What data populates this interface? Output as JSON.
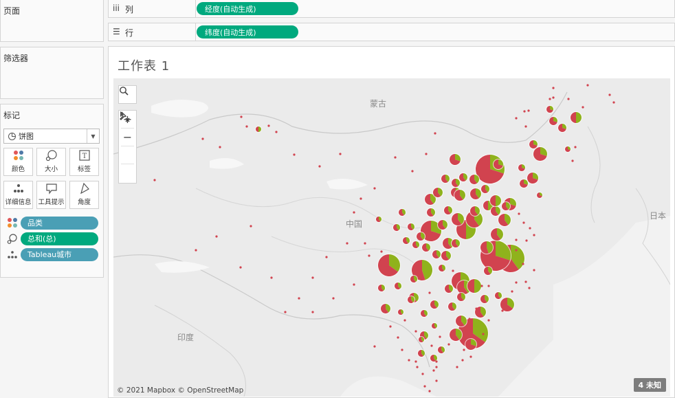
{
  "left": {
    "pages_title": "页面",
    "filters_title": "筛选器",
    "marks_title": "标记",
    "mark_type": "饼图",
    "mark_buttons": [
      {
        "label": "颜色",
        "icon": "color-dots-icon"
      },
      {
        "label": "大小",
        "icon": "size-icon"
      },
      {
        "label": "标签",
        "icon": "label-icon"
      },
      {
        "label": "详细信息",
        "icon": "detail-icon"
      },
      {
        "label": "工具提示",
        "icon": "tooltip-icon"
      },
      {
        "label": "角度",
        "icon": "angle-icon"
      }
    ],
    "pills": [
      {
        "label": "品类",
        "icon": "color-dots-icon",
        "color": "#4a9fb5"
      },
      {
        "label": "总和(总)",
        "icon": "size-icon",
        "color": "#00a97e"
      },
      {
        "label": "Tableau城市",
        "icon": "detail-icon",
        "color": "#4a9fb5"
      }
    ]
  },
  "shelves": {
    "columns": {
      "label": "列",
      "pill": "经度(自动生成)"
    },
    "rows": {
      "label": "行",
      "pill": "纬度(自动生成)"
    }
  },
  "sheet": {
    "title": "工作表 1",
    "map_labels": {
      "mongolia": "蒙古",
      "china": "中国",
      "india": "印度",
      "japan": "日本"
    },
    "attribution": "© 2021 Mapbox © OpenStreetMap",
    "unknown_badge": "4 未知"
  },
  "colors": {
    "pie_red": "#d1434f",
    "pie_green": "#8fb21c",
    "pill_green": "#00a97e",
    "pill_blue": "#4a9fb5"
  }
}
